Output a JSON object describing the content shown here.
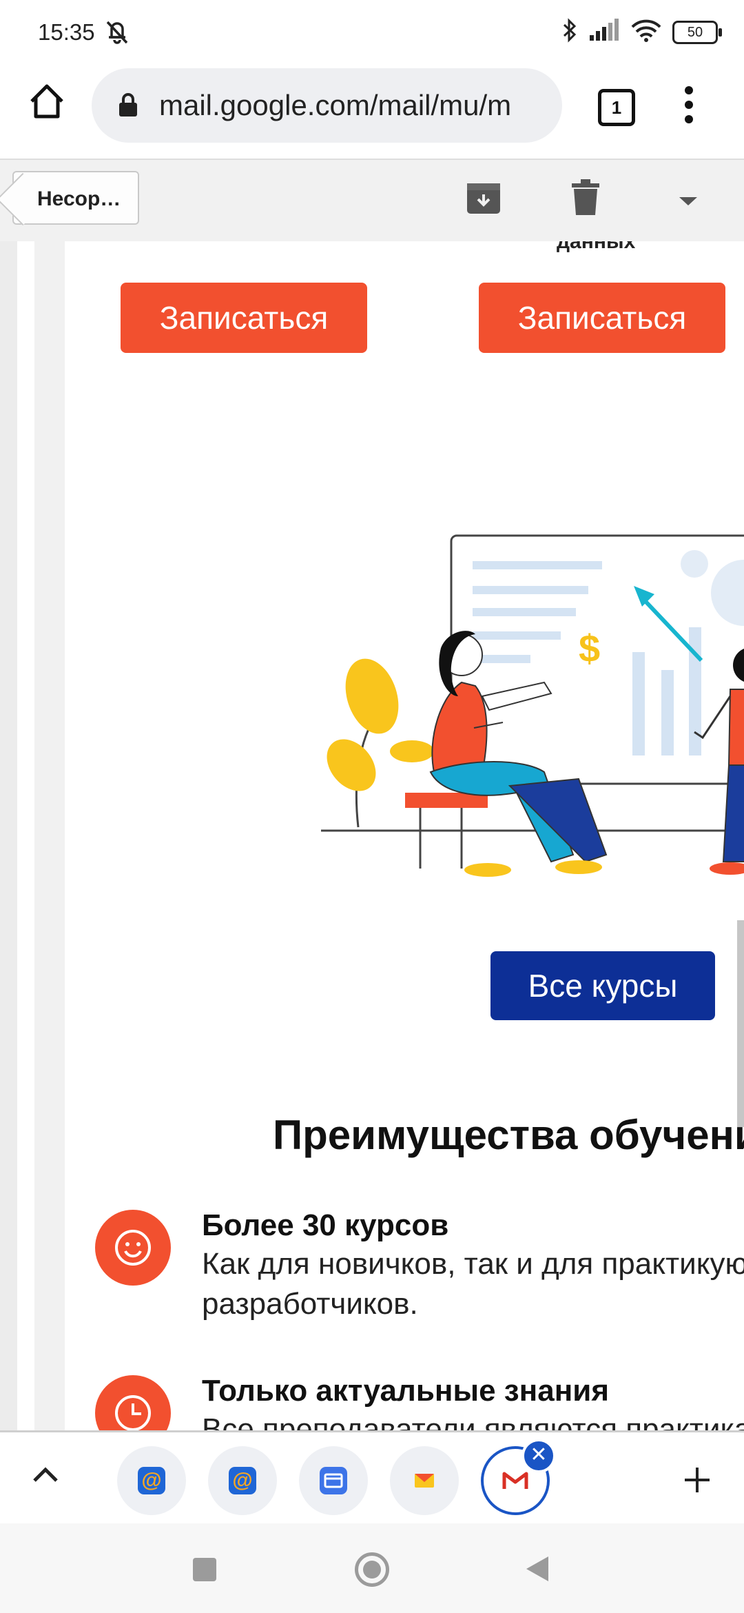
{
  "status_bar": {
    "time": "15:35",
    "battery": "50"
  },
  "browser": {
    "url": "mail.google.com/mail/mu/m",
    "tab_count": "1"
  },
  "gmail_toolbar": {
    "back_label": "Несор…"
  },
  "email": {
    "cut_text": "данных",
    "signup_left": "Записаться",
    "signup_right": "Записаться",
    "all_courses": "Все курсы",
    "section_title": "Преимущества обучения",
    "benefits": [
      {
        "title": "Более 30 курсов",
        "desc_line1": "Как для новичков, так и для практикующих",
        "desc_line2": "разработчиков.",
        "icon": "smile-icon"
      },
      {
        "title": "Только актуальные знания",
        "desc_line1": "Все преподаватели являются практиками",
        "icon": "clock-icon"
      }
    ]
  },
  "bubbles": [
    {
      "name": "mail-ru-app-1",
      "icon": "at-icon"
    },
    {
      "name": "mail-ru-app-2",
      "icon": "at-icon"
    },
    {
      "name": "mail-app",
      "icon": "envelope-icon"
    },
    {
      "name": "yandex-mail-app",
      "icon": "envelope-icon"
    },
    {
      "name": "gmail-app",
      "icon": "gmail-icon"
    }
  ],
  "colors": {
    "accent_red": "#f2502f",
    "button_blue": "#0d2f96",
    "bubble_blue": "#1a55c5"
  }
}
